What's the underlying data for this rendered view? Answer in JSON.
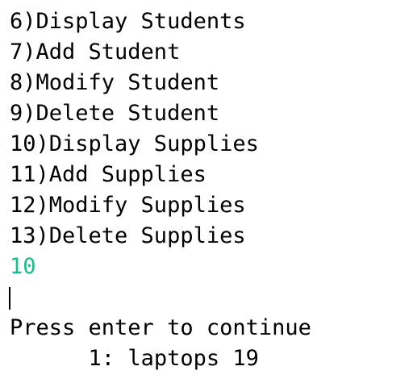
{
  "console": {
    "partial_top_line": "",
    "menu_items": [
      "6)Display Students",
      "7)Add Student",
      "8)Modify Student",
      "9)Delete Student",
      "10)Display Supplies",
      "11)Add Supplies",
      "12)Modify Supplies",
      "13)Delete Supplies"
    ],
    "user_input": "10",
    "output_line": "1: laptops 19",
    "prompt": "Press enter to continue",
    "colors": {
      "background": "#ffffff",
      "text": "#000000",
      "input": "#16c08a"
    }
  }
}
